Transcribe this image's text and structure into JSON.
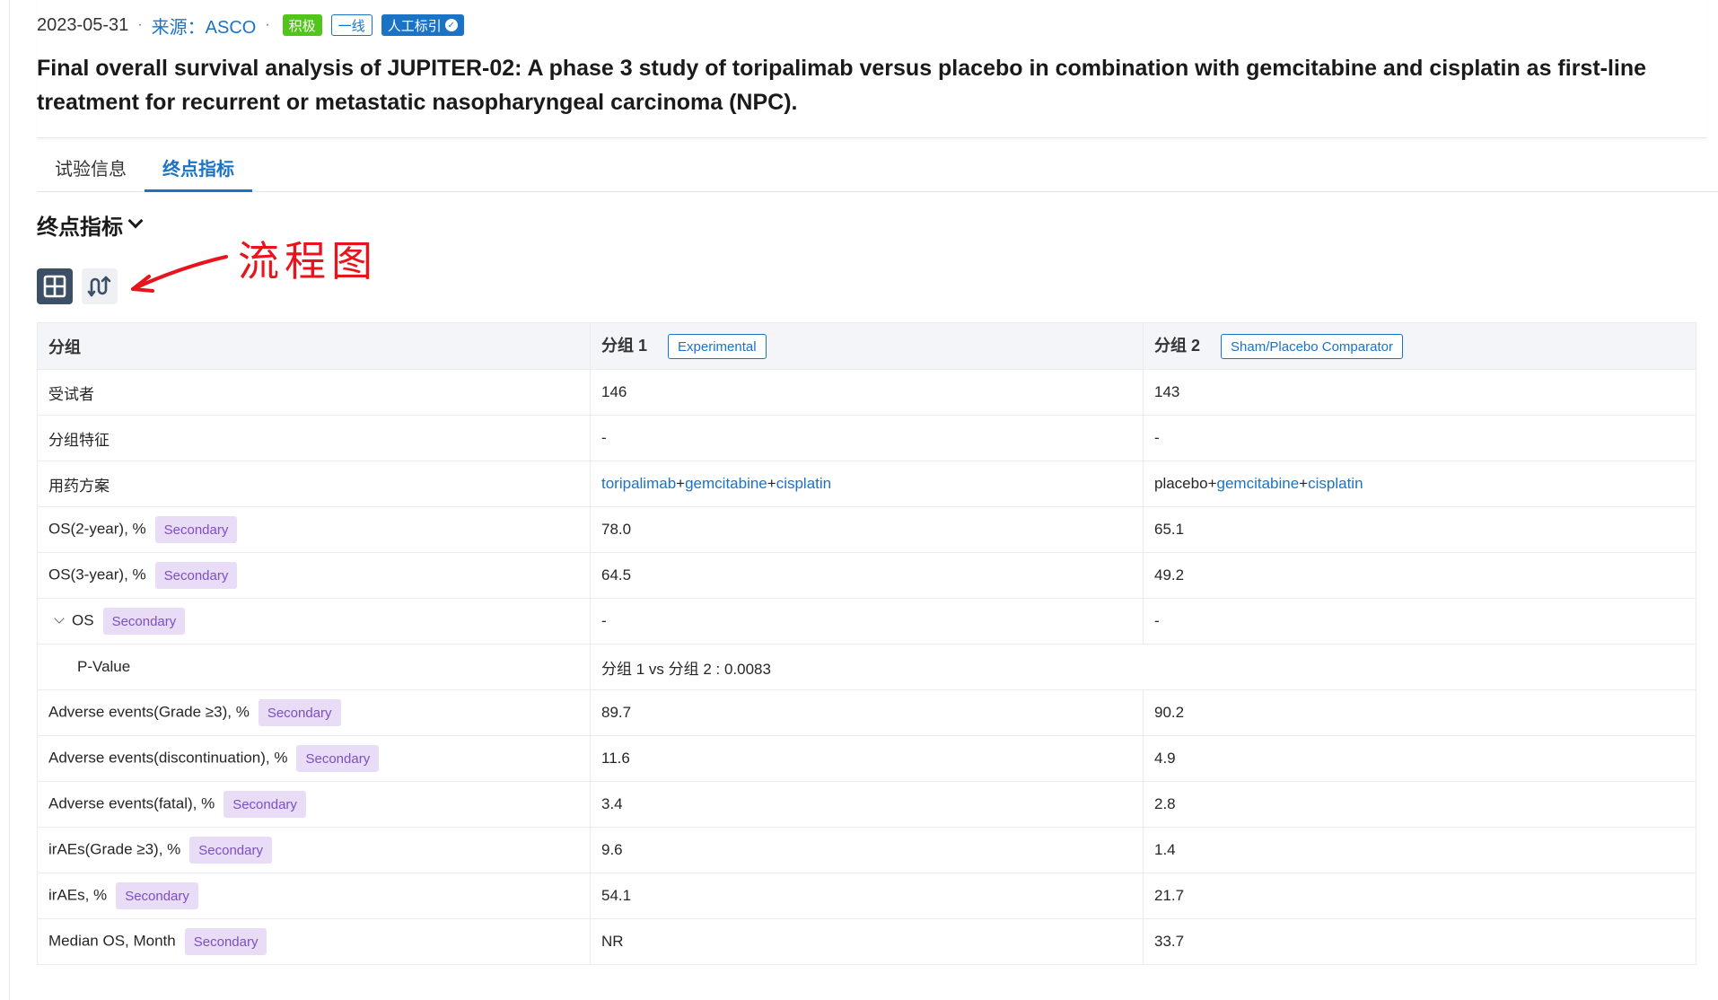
{
  "meta": {
    "date": "2023-05-31",
    "separator": "·",
    "source": "来源：ASCO",
    "tag_active": "积极",
    "tag_line": "一线",
    "tag_manual": "人工标引"
  },
  "title": "Final overall survival analysis of JUPITER-02: A phase 3 study of toripalimab versus placebo in combination with gemcitabine and cisplatin as first-line treatment for recurrent or metastatic nasopharyngeal carcinoma (NPC).",
  "tabs": [
    {
      "label": "试验信息",
      "active": false
    },
    {
      "label": "终点指标",
      "active": true
    }
  ],
  "section": {
    "title": "终点指标"
  },
  "view_toggle": {
    "table_icon": "grid-icon",
    "flow_icon": "flow-chart-icon",
    "active": "table"
  },
  "annotation": {
    "text": "流程图",
    "color": "#e8141c"
  },
  "table": {
    "header": {
      "col1": "分组",
      "col2": "分组 1",
      "col2_tag": "Experimental",
      "col3": "分组 2",
      "col3_tag": "Sham/Placebo Comparator"
    },
    "rows": [
      {
        "label": "受试者",
        "g1": "146",
        "g2": "143"
      },
      {
        "label": "分组特征",
        "g1": "-",
        "g2": "-"
      },
      {
        "label": "用药方案",
        "g1_drugs": [
          "toripalimab",
          "gemcitabine",
          "cisplatin"
        ],
        "g2_drugs": [
          "placebo",
          "gemcitabine",
          "cisplatin"
        ],
        "plus": "+"
      },
      {
        "label": "OS(2-year), %",
        "tag": "Secondary",
        "g1": "78.0",
        "g2": "65.1"
      },
      {
        "label": "OS(3-year), %",
        "tag": "Secondary",
        "g1": "64.5",
        "g2": "49.2"
      },
      {
        "label": "OS",
        "tag": "Secondary",
        "g1": "-",
        "g2": "-"
      },
      {
        "label": "P-Value",
        "comparison": "分组 1 vs 分组 2 : 0.0083"
      },
      {
        "label": "Adverse events(Grade ≥3), %",
        "tag": "Secondary",
        "g1": "89.7",
        "g2": "90.2"
      },
      {
        "label": "Adverse events(discontinuation), %",
        "tag": "Secondary",
        "g1": "11.6",
        "g2": "4.9"
      },
      {
        "label": "Adverse events(fatal), %",
        "tag": "Secondary",
        "g1": "3.4",
        "g2": "2.8"
      },
      {
        "label": "irAEs(Grade ≥3), %",
        "tag": "Secondary",
        "g1": "9.6",
        "g2": "1.4"
      },
      {
        "label": "irAEs, %",
        "tag": "Secondary",
        "g1": "54.1",
        "g2": "21.7"
      },
      {
        "label": "Median OS, Month",
        "tag": "Secondary",
        "g1": "NR",
        "g2": "33.7"
      }
    ]
  },
  "colors": {
    "accent": "#1a73c4",
    "active_tag": "#52c41a",
    "secondary_tag_bg": "#e9dcf7",
    "secondary_tag_text": "#7d4fc0"
  }
}
